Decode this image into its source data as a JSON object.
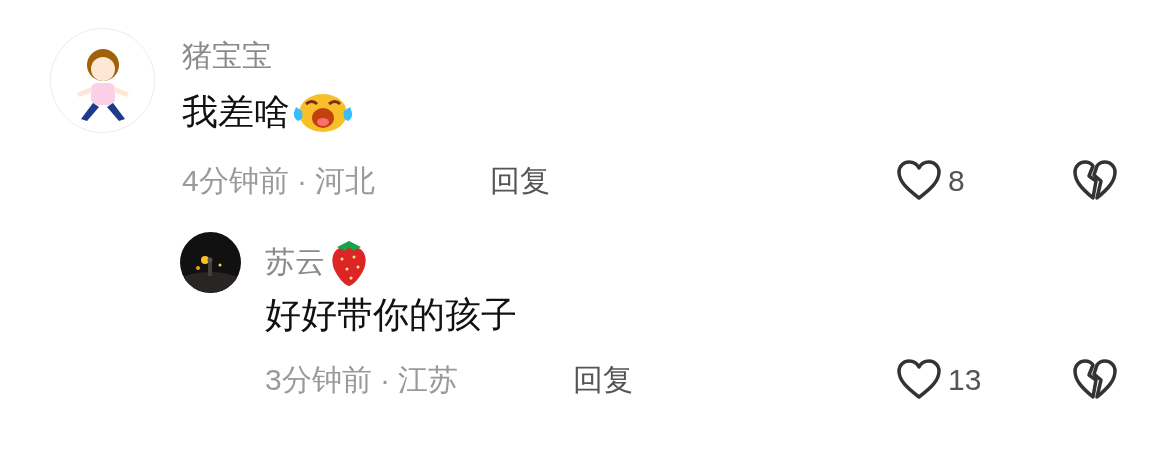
{
  "comments": [
    {
      "name": "猪宝宝",
      "text": "我差啥",
      "text_icon": {
        "kind": "crying-face"
      },
      "meta": "4分钟前 · 河北",
      "reply": "回复",
      "likes": "8",
      "children": [
        {
          "name": "苏云",
          "name_icon": {
            "kind": "strawberry"
          },
          "text": "好好带你的孩子",
          "meta": "3分钟前 · 江苏",
          "reply": "回复",
          "likes": "13"
        }
      ]
    }
  ]
}
